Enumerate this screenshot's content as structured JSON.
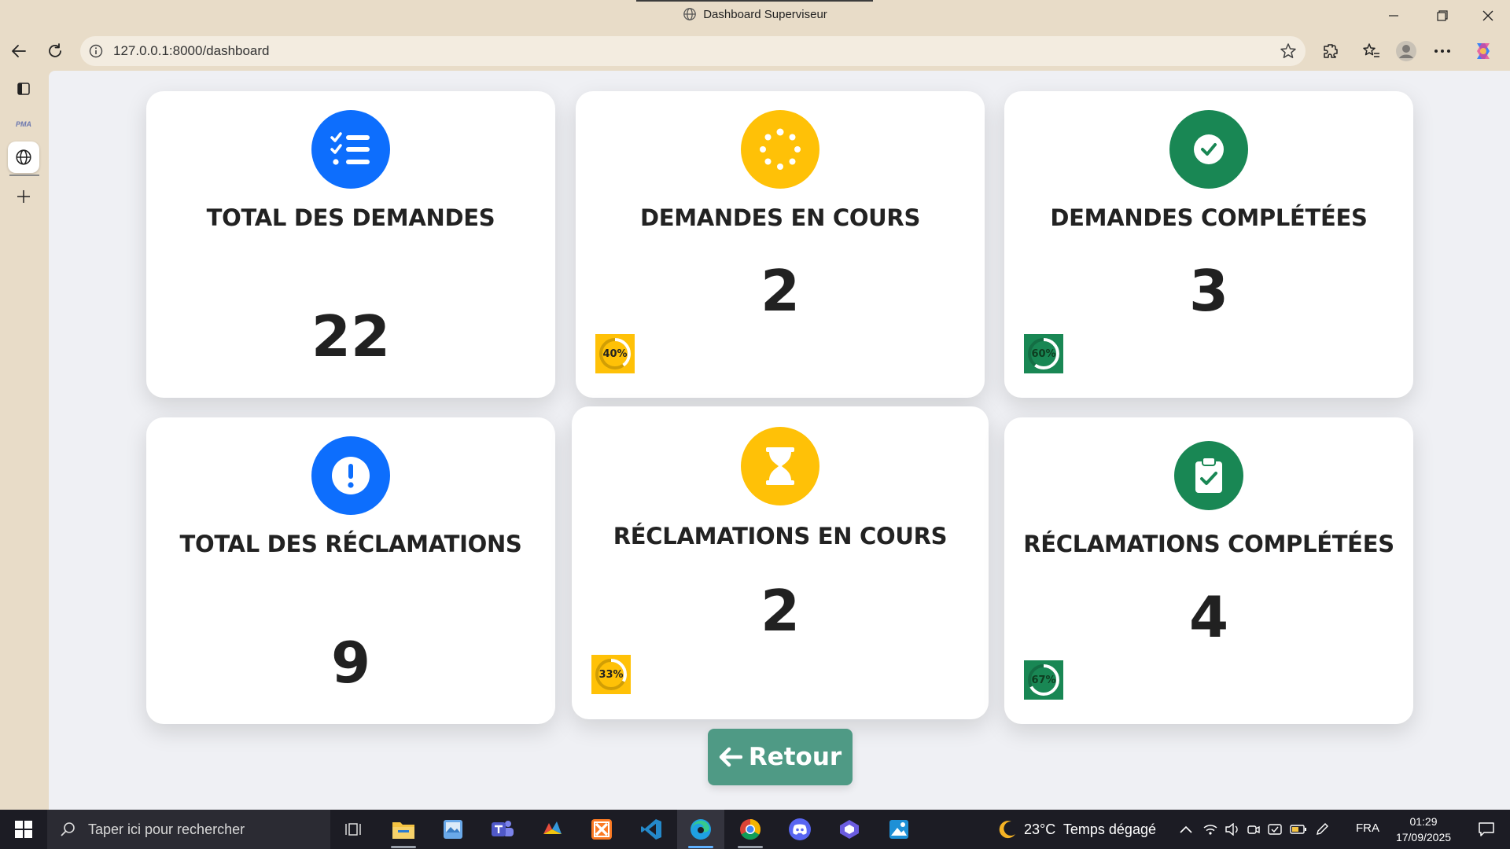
{
  "window": {
    "title": "Dashboard Superviseur"
  },
  "browser": {
    "url": "127.0.0.1:8000/dashboard",
    "sidebar_logo_text": "PMA"
  },
  "cards": [
    {
      "title": "TOTAL DES DEMANDES",
      "value": "22",
      "icon": "list-check-icon",
      "color": "#0d6efd"
    },
    {
      "title": "DEMANDES EN COURS",
      "value": "2",
      "icon": "spinner-icon",
      "color": "#ffc107",
      "badge": "40%",
      "progress": 0.4
    },
    {
      "title": "DEMANDES COMPLÉTÉES",
      "value": "3",
      "icon": "check-circle-icon",
      "color": "#198754",
      "badge": "60%",
      "progress": 0.6
    },
    {
      "title": "TOTAL DES RÉCLAMATIONS",
      "value": "9",
      "icon": "exclamation-circle-icon",
      "color": "#0d6efd"
    },
    {
      "title": "RÉCLAMATIONS EN COURS",
      "value": "2",
      "icon": "hourglass-icon",
      "color": "#ffc107",
      "badge": "33%",
      "progress": 0.33
    },
    {
      "title": "RÉCLAMATIONS COMPLÉTÉES",
      "value": "4",
      "icon": "clipboard-check-icon",
      "color": "#198754",
      "badge": "67%",
      "progress": 0.67
    }
  ],
  "retour_button": {
    "label": "Retour",
    "icon": "arrow-left-icon",
    "color": "#4f9a85"
  },
  "taskbar": {
    "search_placeholder": "Taper ici pour rechercher",
    "weather": "23°C  Temps dégagé",
    "language": "FRA",
    "time": "01:29",
    "date": "17/09/2025"
  }
}
